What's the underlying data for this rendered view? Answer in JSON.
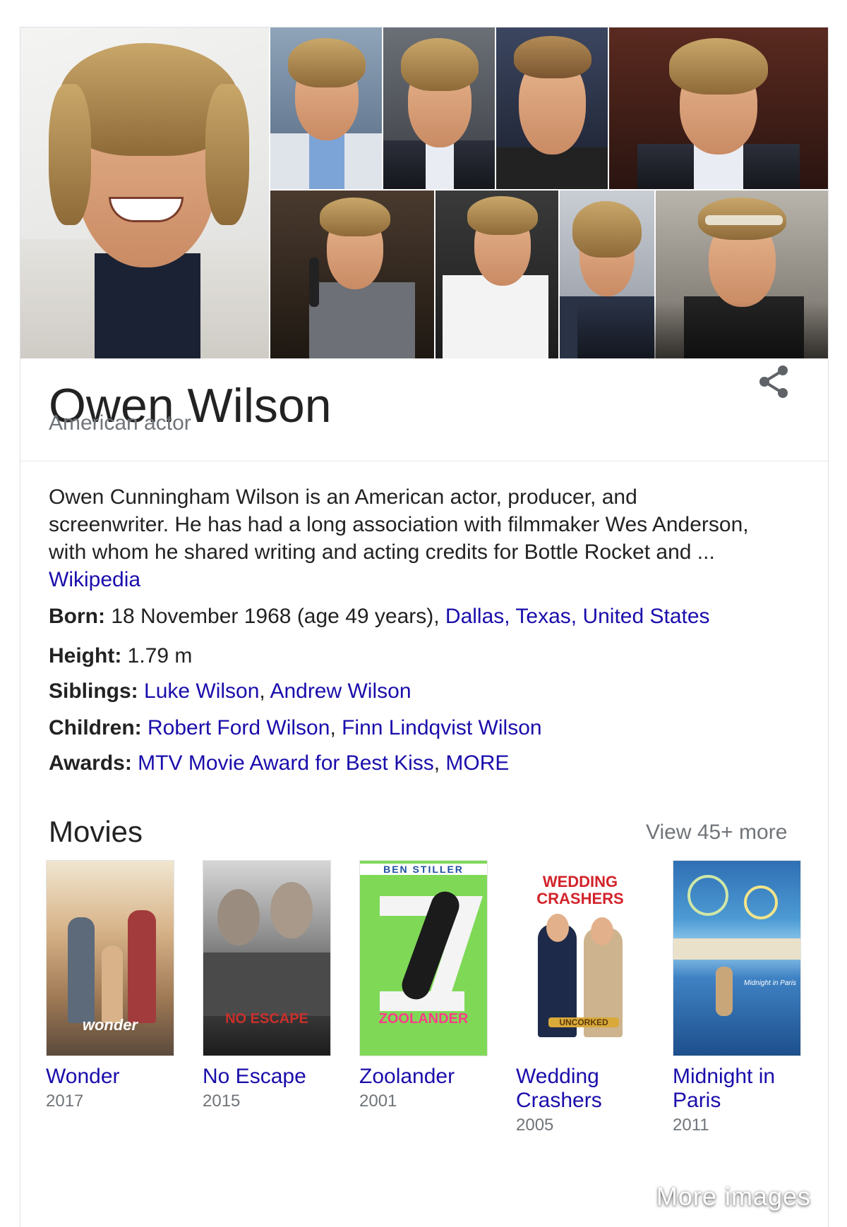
{
  "gallery": {
    "more_images_label": "More images"
  },
  "entity": {
    "name": "Owen Wilson",
    "type": "American actor"
  },
  "description": {
    "text": "Owen Cunningham Wilson is an American actor, producer, and screenwriter. He has had a long association with filmmaker Wes Anderson, with whom he shared writing and acting credits for Bottle Rocket and ... ",
    "source_link": "Wikipedia"
  },
  "facts": {
    "born": {
      "label": "Born:",
      "value": " 18 November 1968 (age 49 years), ",
      "place": "Dallas, Texas, United States"
    },
    "height": {
      "label": "Height:",
      "value": " 1.79 m"
    },
    "siblings": {
      "label": "Siblings:",
      "links": [
        "Luke Wilson",
        "Andrew Wilson"
      ]
    },
    "children": {
      "label": "Children:",
      "links": [
        "Robert Ford Wilson",
        "Finn Lindqvist Wilson"
      ]
    },
    "awards": {
      "label": "Awards:",
      "links": [
        "MTV Movie Award for Best Kiss",
        "MORE"
      ]
    },
    "separator": ", "
  },
  "movies": {
    "heading": "Movies",
    "view_more": "View 45+ more",
    "items": [
      {
        "title": "Wonder",
        "year": "2017",
        "poster_text": "wonder"
      },
      {
        "title": "No Escape",
        "year": "2015",
        "poster_text": "NO ESCAPE"
      },
      {
        "title": "Zoolander",
        "year": "2001",
        "poster_text": "ZOOLANDER",
        "poster_top_text": "BEN STILLER"
      },
      {
        "title": "Wedding Crashers",
        "year": "2005",
        "poster_text": "WEDDING CRASHERS",
        "poster_badge": "UNCORKED"
      },
      {
        "title": "Midnight in Paris",
        "year": "2011",
        "poster_text": "Midnight in Paris"
      }
    ]
  },
  "colors": {
    "link": "#1a0dab",
    "muted": "#70757a",
    "text": "#222222"
  }
}
